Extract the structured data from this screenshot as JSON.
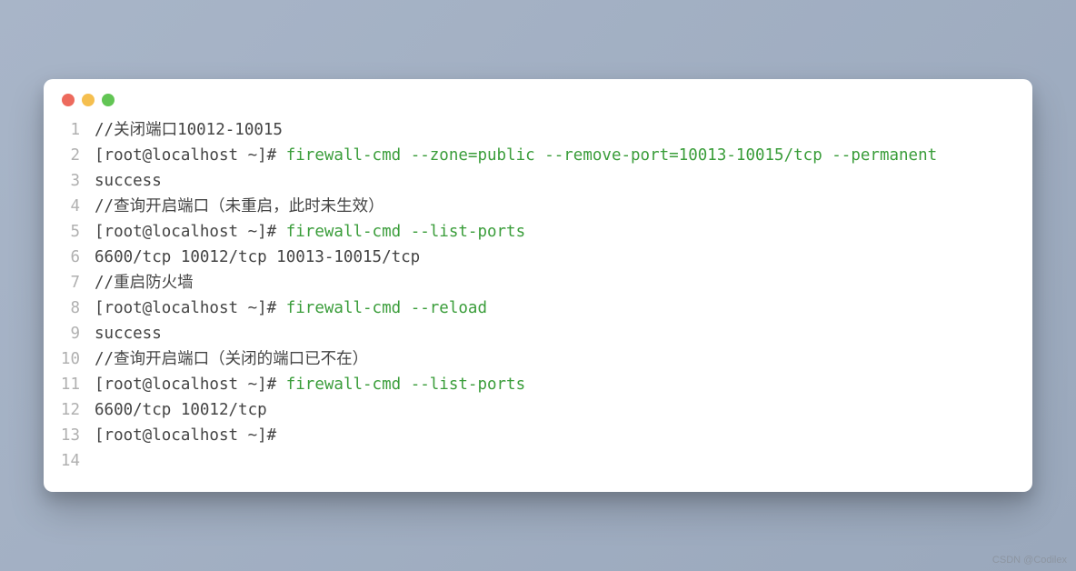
{
  "lines": [
    {
      "num": "1",
      "segments": [
        {
          "cls": "prompt",
          "t": "//关闭端口10012-10015"
        }
      ]
    },
    {
      "num": "2",
      "segments": [
        {
          "cls": "prompt",
          "t": "[root@localhost ~]#"
        },
        {
          "cls": "cmd",
          "t": " firewall-cmd --zone=public --remove-port=10013-10015/tcp --permanent"
        }
      ]
    },
    {
      "num": "3",
      "segments": [
        {
          "cls": "prompt",
          "t": "success"
        }
      ]
    },
    {
      "num": "4",
      "segments": [
        {
          "cls": "prompt",
          "t": "//查询开启端口（未重启，此时未生效）"
        }
      ]
    },
    {
      "num": "5",
      "segments": [
        {
          "cls": "prompt",
          "t": "[root@localhost ~]#"
        },
        {
          "cls": "cmd",
          "t": " firewall-cmd --list-ports"
        }
      ]
    },
    {
      "num": "6",
      "segments": [
        {
          "cls": "prompt",
          "t": "6600/tcp 10012/tcp 10013-10015/tcp"
        }
      ]
    },
    {
      "num": "7",
      "segments": [
        {
          "cls": "prompt",
          "t": "//重启防火墙"
        }
      ]
    },
    {
      "num": "8",
      "segments": [
        {
          "cls": "prompt",
          "t": "[root@localhost ~]#"
        },
        {
          "cls": "cmd",
          "t": " firewall-cmd --reload"
        }
      ]
    },
    {
      "num": "9",
      "segments": [
        {
          "cls": "prompt",
          "t": "success"
        }
      ]
    },
    {
      "num": "10",
      "segments": [
        {
          "cls": "prompt",
          "t": "//查询开启端口（关闭的端口已不在）"
        }
      ]
    },
    {
      "num": "11",
      "segments": [
        {
          "cls": "prompt",
          "t": "[root@localhost ~]#"
        },
        {
          "cls": "cmd",
          "t": " firewall-cmd --list-ports"
        }
      ]
    },
    {
      "num": "12",
      "segments": [
        {
          "cls": "prompt",
          "t": "6600/tcp 10012/tcp"
        }
      ]
    },
    {
      "num": "13",
      "segments": [
        {
          "cls": "prompt",
          "t": "[root@localhost ~]#"
        }
      ]
    },
    {
      "num": "14",
      "segments": [
        {
          "cls": "prompt",
          "t": ""
        }
      ]
    }
  ],
  "watermark": "CSDN @Codilex"
}
